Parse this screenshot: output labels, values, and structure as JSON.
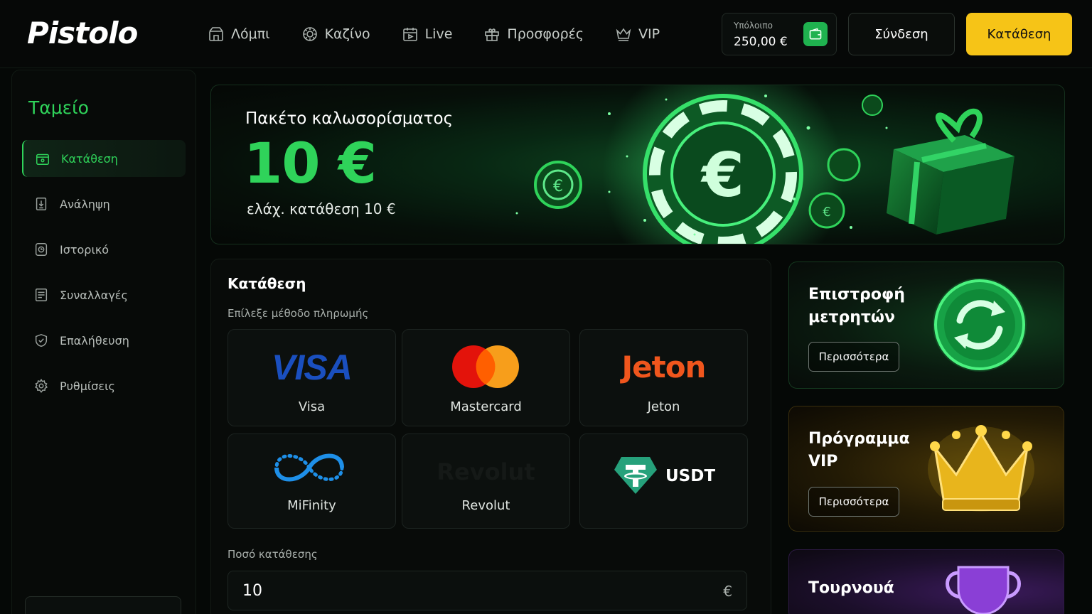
{
  "header": {
    "logo": "Pistolo",
    "nav": [
      {
        "label": "Λόμπι",
        "icon": "lobby-icon"
      },
      {
        "label": "Καζίνο",
        "icon": "casino-chip-icon"
      },
      {
        "label": "Live",
        "icon": "live-calendar-icon"
      },
      {
        "label": "Προσφορές",
        "icon": "gift-icon"
      },
      {
        "label": "VIP",
        "icon": "crown-icon"
      }
    ],
    "balance_label": "Υπόλοιπο",
    "balance_value": "250,00 €",
    "login_label": "Σύνδεση",
    "deposit_label": "Κατάθεση"
  },
  "sidebar": {
    "title": "Ταμείο",
    "items": [
      {
        "label": "Κατάθεση",
        "icon": "deposit-icon",
        "active": true
      },
      {
        "label": "Ανάληψη",
        "icon": "withdraw-icon"
      },
      {
        "label": "Ιστορικό",
        "icon": "history-icon"
      },
      {
        "label": "Συναλλαγές",
        "icon": "transactions-icon"
      },
      {
        "label": "Επαλήθευση",
        "icon": "verification-icon"
      },
      {
        "label": "Ρυθμίσεις",
        "icon": "settings-icon"
      }
    ]
  },
  "hero": {
    "title": "Πακέτο καλωσορίσματος",
    "amount": "10 €",
    "subtitle": "ελάχ. κατάθεση 10 €"
  },
  "deposit": {
    "title": "Κατάθεση",
    "subtitle": "Επίλεξε μέθοδο πληρωμής",
    "methods": [
      {
        "name": "Visa",
        "logo": "VISA"
      },
      {
        "name": "Mastercard",
        "logo": "mastercard-logo"
      },
      {
        "name": "Jeton",
        "logo": "Jeton"
      },
      {
        "name": "MiFinity",
        "logo": "mifinity-logo"
      },
      {
        "name": "Revolut",
        "logo": "Revolut"
      },
      {
        "name": "",
        "logo": "USDT"
      }
    ],
    "amount_label": "Ποσό κατάθεσης",
    "amount_value": "10",
    "currency": "€"
  },
  "promos": [
    {
      "title_line1": "Επιστροφή",
      "title_line2": "μετρητών",
      "button": "Περισσότερα",
      "icon": "cashback-icon"
    },
    {
      "title_line1": "Πρόγραμμα",
      "title_line2": "VIP",
      "button": "Περισσότερα",
      "icon": "crown-icon"
    },
    {
      "title_line1": "Τουρνουά",
      "title_line2": "",
      "button": "",
      "icon": "trophy-icon"
    }
  ],
  "colors": {
    "accent_green": "#2fd35a",
    "accent_yellow": "#f6c417",
    "background": "#050806"
  }
}
